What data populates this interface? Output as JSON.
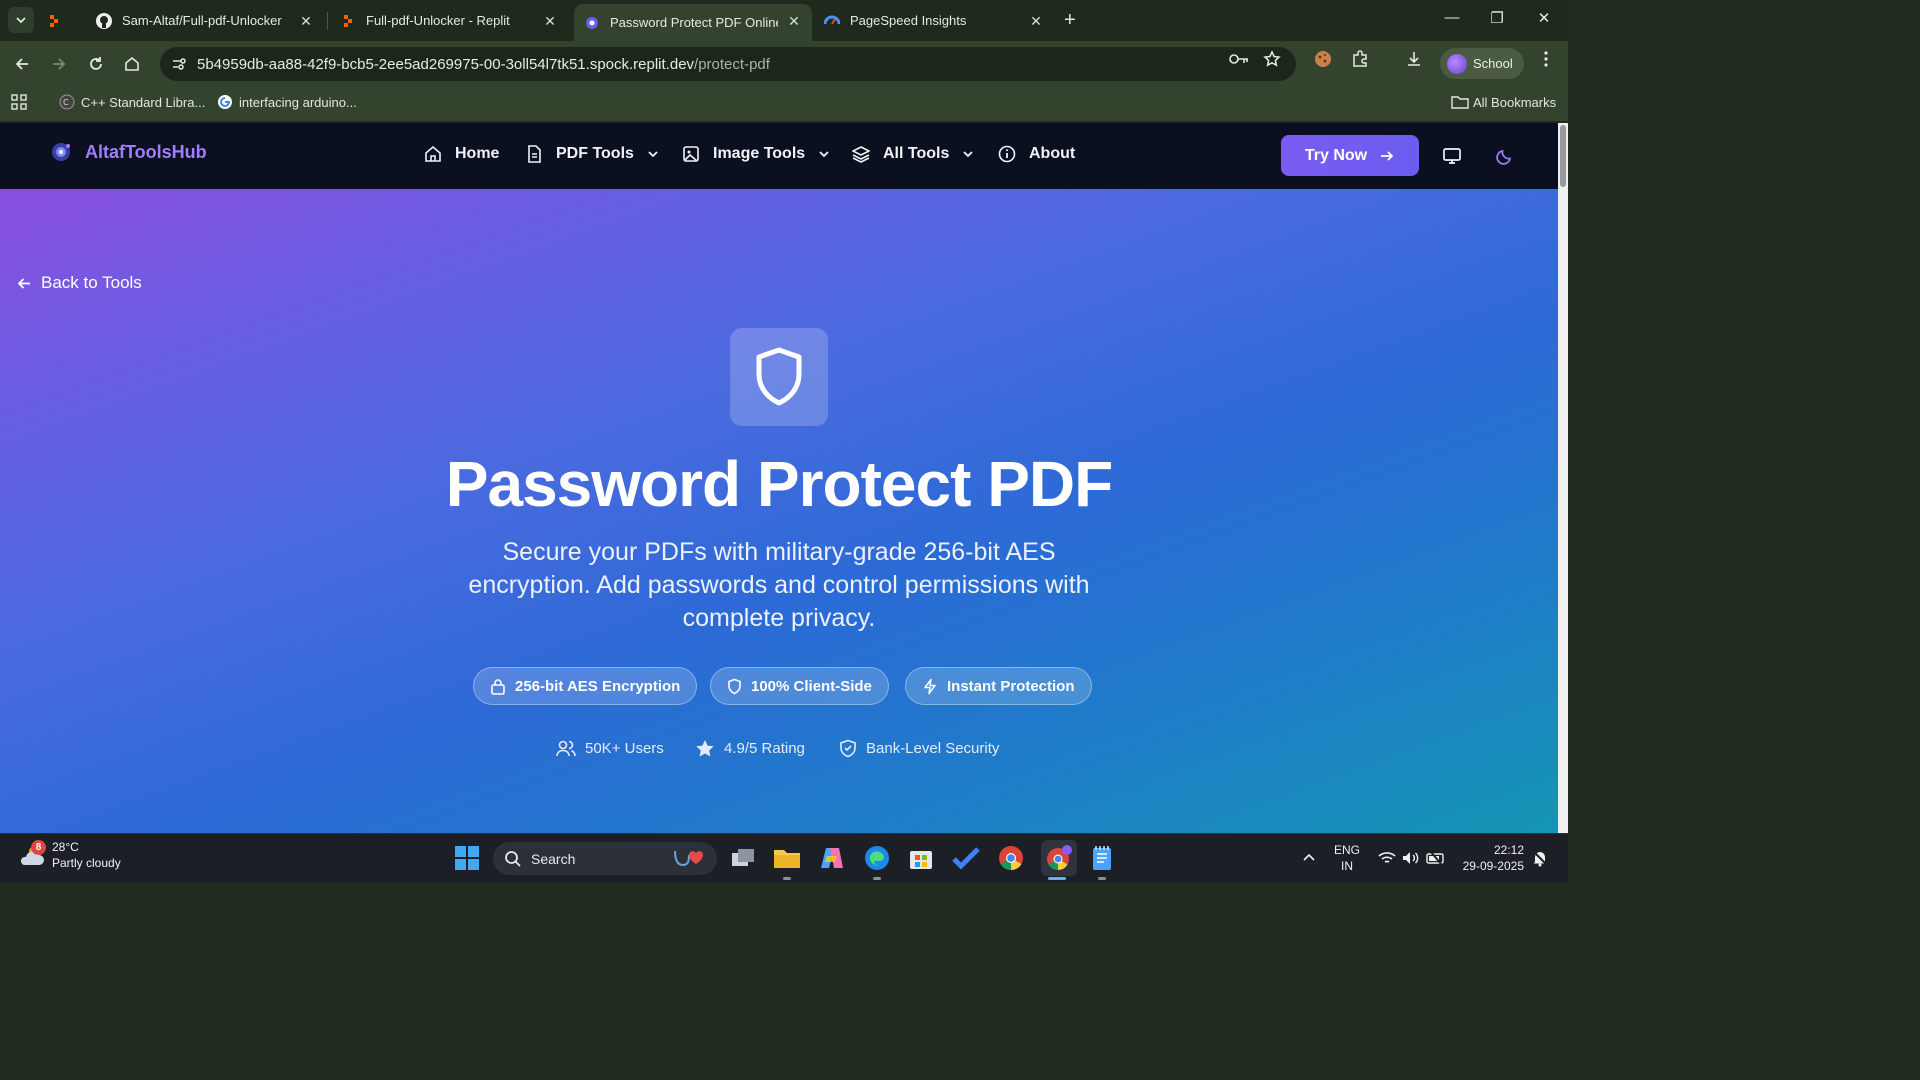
{
  "browser": {
    "tabs": [
      {
        "title": "",
        "favicon": "replit-icon"
      },
      {
        "title": "Sam-Altaf/Full-pdf-Unlocker",
        "favicon": "github-icon"
      },
      {
        "title": "Full-pdf-Unlocker - Replit",
        "favicon": "replit-icon"
      },
      {
        "title": "Password Protect PDF Online Fr",
        "favicon": "altaf-logo-icon",
        "active": true
      },
      {
        "title": "PageSpeed Insights",
        "favicon": "pagespeed-icon"
      }
    ],
    "url": {
      "host": "5b4959db-aa88-42f9-bcb5-2ee5ad269975-00-3oll54l7tk51.spock.replit.dev",
      "path": "/protect-pdf"
    },
    "profile_label": "School",
    "bookmarks": [
      {
        "label": "C++ Standard Libra..."
      },
      {
        "label": "interfacing arduino..."
      }
    ],
    "all_bookmarks_label": "All Bookmarks"
  },
  "site": {
    "brand": "AltafToolsHub",
    "nav": [
      {
        "label": "Home",
        "icon": "home-icon",
        "dropdown": false
      },
      {
        "label": "PDF Tools",
        "icon": "document-icon",
        "dropdown": true
      },
      {
        "label": "Image Tools",
        "icon": "image-icon",
        "dropdown": true
      },
      {
        "label": "All Tools",
        "icon": "layers-icon",
        "dropdown": true
      },
      {
        "label": "About",
        "icon": "info-icon",
        "dropdown": false
      }
    ],
    "cta_label": "Try Now",
    "accent_color": "#7b5cf2"
  },
  "hero": {
    "back_label": "Back to Tools",
    "title": "Password Protect PDF",
    "subtitle": "Secure your PDFs with military-grade 256-bit AES encryption. Add passwords and control permissions with complete privacy.",
    "features": [
      {
        "label": "256-bit AES Encryption",
        "icon": "lock-icon"
      },
      {
        "label": "100% Client-Side",
        "icon": "shield-icon"
      },
      {
        "label": "Instant Protection",
        "icon": "lightning-icon"
      }
    ],
    "stats": [
      {
        "label": "50K+ Users",
        "icon": "users-icon"
      },
      {
        "label": "4.9/5 Rating",
        "icon": "star-icon"
      },
      {
        "label": "Bank-Level Security",
        "icon": "shield-check-icon"
      }
    ]
  },
  "taskbar": {
    "weather": {
      "temp": "28°C",
      "condition": "Partly cloudy",
      "badge": "8"
    },
    "search_label": "Search",
    "language": {
      "line1": "ENG",
      "line2": "IN"
    },
    "clock": {
      "time": "22:12",
      "date": "29-09-2025"
    }
  }
}
